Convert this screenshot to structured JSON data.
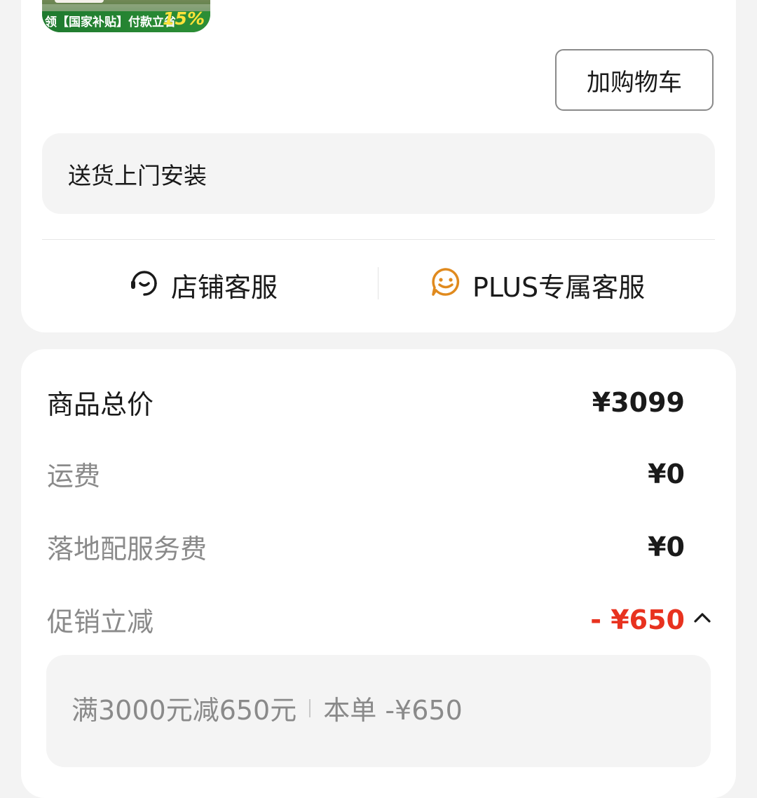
{
  "product_card": {
    "thumbnail_banner_text": "领【国家补贴】付款立省",
    "thumbnail_banner_percent": "15%",
    "add_to_cart_label": "加购物车",
    "service_option": "送货上门安装",
    "store_service_label": "店铺客服",
    "plus_service_label": "PLUS专属客服",
    "icons": {
      "store_service": "headset-icon",
      "plus_service": "smiley-chat-icon",
      "plus_service_color": "#e08a1e"
    }
  },
  "price_summary": {
    "rows": [
      {
        "label": "商品总价",
        "value": "¥3099"
      },
      {
        "label": "运费",
        "value": "¥0"
      },
      {
        "label": "落地配服务费",
        "value": "¥0"
      },
      {
        "label": "促销立减",
        "value": "- ¥650"
      }
    ],
    "promo_detail": {
      "rule": "满3000元减650元",
      "this_order": "本单 -¥650"
    },
    "discount_color": "#e8321f"
  }
}
